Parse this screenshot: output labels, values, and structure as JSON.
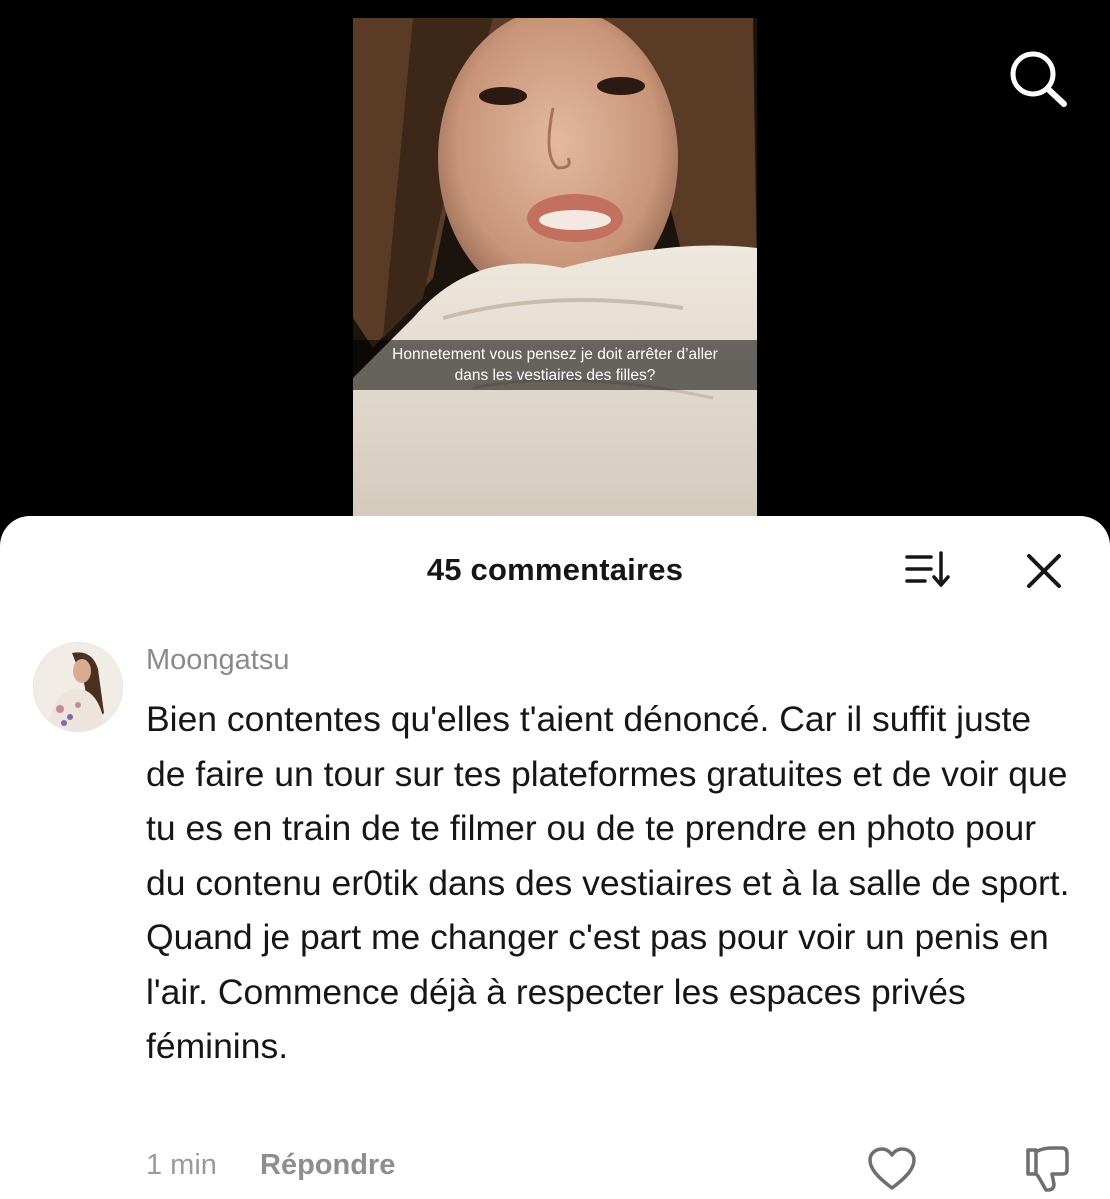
{
  "video": {
    "caption_line1": "Honnetement vous pensez je doit arrêter d’aller",
    "caption_line2": "dans les vestiaires des filles?"
  },
  "header": {
    "search_icon": "search-icon"
  },
  "comments_panel": {
    "title": "45 commentaires",
    "sort_icon": "sort-icon",
    "close_icon": "close-icon"
  },
  "comment": {
    "username": "Moongatsu",
    "text": "Bien contentes qu'elles t'aient dénoncé. Car il suffit juste de faire un tour sur tes plateformes gratuites et de voir que tu es en train de te filmer ou de te prendre en photo pour du contenu er0tik dans des vestiaires et à la salle de sport. Quand je part me changer c'est pas pour voir un penis en l'air. Commence déjà à respecter les espaces privés féminins.",
    "timestamp": "1 min",
    "reply_label": "Répondre",
    "like_icon": "heart-icon",
    "dislike_icon": "thumbs-down-icon"
  },
  "colors": {
    "background_top": "#000000",
    "sheet": "#ffffff",
    "primary_text": "#161616",
    "secondary_text": "#8a8a8a"
  }
}
